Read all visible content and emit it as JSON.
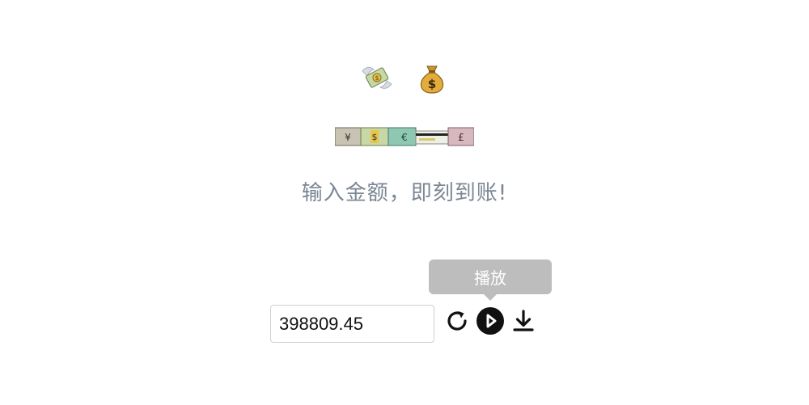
{
  "header": {
    "icons": [
      "money-with-wings-icon",
      "money-bag-icon"
    ],
    "currency_strip_icon": "currency-notes-strip-icon",
    "tagline": "输入金额，即刻到账!"
  },
  "amount": {
    "value": "398809.45"
  },
  "controls": {
    "reset_icon": "refresh-icon",
    "play_icon": "play-icon",
    "download_icon": "download-icon",
    "tooltip_label": "播放"
  }
}
